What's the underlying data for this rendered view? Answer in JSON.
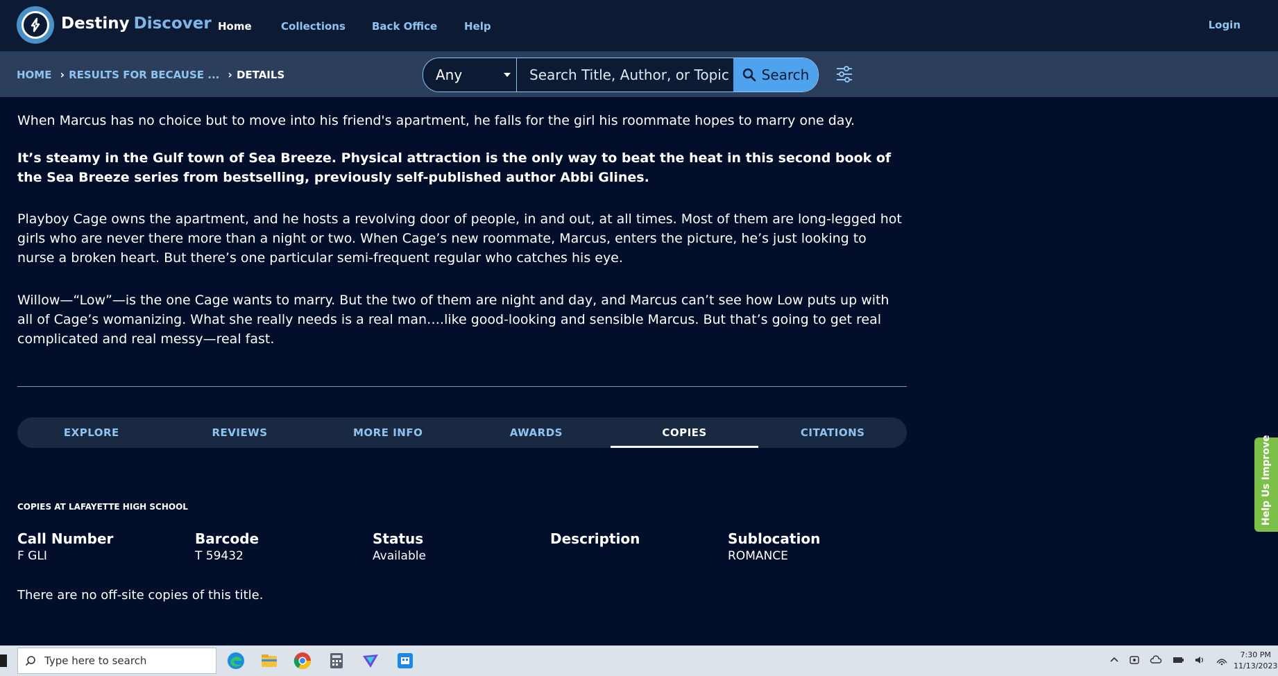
{
  "nav": {
    "brand_part1": "Destiny",
    "brand_part2": "Discover",
    "links": [
      "Home",
      "Collections",
      "Back Office",
      "Help"
    ],
    "login": "Login"
  },
  "breadcrumb": {
    "home": "HOME",
    "results": "RESULTS FOR BECAUSE ...",
    "current": "DETAILS"
  },
  "search": {
    "scope_value": "Any",
    "placeholder": "Search Title, Author, or Topic",
    "button_label": "Search"
  },
  "description": {
    "p1": "When Marcus has no choice but to move into his friend's apartment, he falls for the girl his roommate hopes to marry one day.",
    "p2": "It’s steamy in the Gulf town of Sea Breeze. Physical attraction is the only way to beat the heat in this second book of the Sea Breeze series from bestselling, previously self-published author Abbi Glines.",
    "p3": "Playboy Cage owns the apartment, and he hosts a revolving door of people, in and out, at all times. Most of them are long-legged hot girls who are never there more than a night or two. When Cage’s new roommate, Marcus, enters the picture, he’s just looking to nurse a broken heart. But there’s one particular semi-frequent regular who catches his eye.",
    "p4": "Willow—“Low”—is the one Cage wants to marry. But the two of them are night and day, and Marcus can’t see how Low puts up with all of Cage’s womanizing. What she really needs is a real man….like good-looking and sensible Marcus. But that’s going to get real complicated and real messy—real fast."
  },
  "tabs": [
    "EXPLORE",
    "REVIEWS",
    "MORE INFO",
    "AWARDS",
    "COPIES",
    "CITATIONS"
  ],
  "active_tab": "COPIES",
  "copies": {
    "title": "COPIES AT LAFAYETTE HIGH SCHOOL",
    "columns": [
      "Call Number",
      "Barcode",
      "Status",
      "Description",
      "Sublocation"
    ],
    "row": [
      "F GLI",
      "T 59432",
      "Available",
      "",
      "ROMANCE"
    ],
    "offsite": "There are no off-site copies of this title."
  },
  "feedback_label": "Help Us Improve",
  "taskbar": {
    "search_placeholder": "Type here to search",
    "time": "7:30 PM",
    "date": "11/13/2023"
  },
  "colors": {
    "background": "#020e2a",
    "nav_bg": "#0c1b33",
    "subbar_bg": "#2b3f5c",
    "link": "#8fc4f2",
    "search_button": "#4fa3ee",
    "feedback_green": "#7cc04a"
  }
}
